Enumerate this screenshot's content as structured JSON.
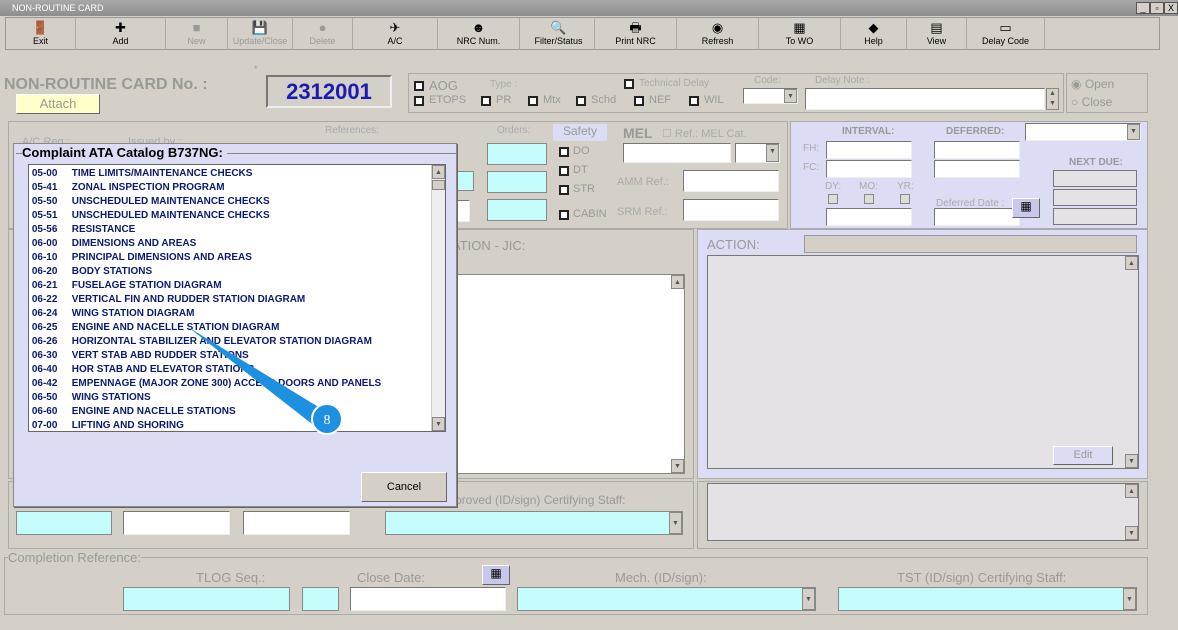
{
  "window": {
    "title": "NON-ROUTINE CARD",
    "min": "_",
    "max": "▫",
    "close": "X"
  },
  "toolbar": [
    {
      "label": "Exit",
      "icon": "exit-icon",
      "glyph": "🚪",
      "enabled": true
    },
    {
      "label": "Add",
      "icon": "plus-icon",
      "glyph": "✚",
      "enabled": true
    },
    {
      "label": "New",
      "icon": "new-icon",
      "glyph": "■",
      "enabled": false
    },
    {
      "label": "Update/Close",
      "icon": "save-icon",
      "glyph": "💾",
      "enabled": false
    },
    {
      "label": "Delete",
      "icon": "delete-icon",
      "glyph": "●",
      "enabled": false
    },
    {
      "label": "A/C",
      "icon": "aircraft-icon",
      "glyph": "✈",
      "enabled": true
    },
    {
      "label": "NRC Num.",
      "icon": "search-people-icon",
      "glyph": "☻",
      "enabled": true
    },
    {
      "label": "Filter/Status",
      "icon": "magnifier-icon",
      "glyph": "🔍",
      "enabled": true
    },
    {
      "label": "Print NRC",
      "icon": "printer-icon",
      "glyph": "🖶",
      "enabled": true
    },
    {
      "label": "Refresh",
      "icon": "refresh-icon",
      "glyph": "◉",
      "enabled": true
    },
    {
      "label": "To WO",
      "icon": "to-wo-icon",
      "glyph": "▦",
      "enabled": true
    },
    {
      "label": "Help",
      "icon": "help-icon",
      "glyph": "◆",
      "enabled": true
    },
    {
      "label": "View",
      "icon": "view-icon",
      "glyph": "▤",
      "enabled": true
    },
    {
      "label": "Delay Code",
      "icon": "delay-code-icon",
      "glyph": "▭",
      "enabled": true
    }
  ],
  "header": {
    "title": "NON-ROUTINE CARD No. :",
    "attach": "Attach",
    "card_no": "2312001",
    "required": "*"
  },
  "flags": {
    "aog": "AOG",
    "etops": "ETOPS",
    "type_label": "Type :",
    "pr": "PR",
    "mtx": "Mtx",
    "schd": "Schd",
    "nef": "NEF",
    "wil": "WIL",
    "tech_delay": "Technical Delay",
    "code": "Code:",
    "delay_note": "Delay Note :",
    "open": "Open",
    "close": "Close",
    "status": "Open"
  },
  "refs": {
    "ac_reg": "A/C Reg.:",
    "issued_by": "Issued by :",
    "references": "References:",
    "orders": "Orders:",
    "safety": "Safety",
    "do": "DO",
    "dt": "DT",
    "str": "STR",
    "cabin": "CABIN",
    "mel": "MEL",
    "ref_mel_cat": "Ref.: MEL Cat.",
    "amm": "AMM Ref.:",
    "srm": "SRM Ref.:"
  },
  "interval": {
    "interval": "INTERVAL:",
    "deferred": "DEFERRED:",
    "fh": "FH:",
    "fc": "FC:",
    "dy": "DY:",
    "mo": "MO:",
    "yr": "YR:",
    "deferred_date": "Deferred Date :",
    "next_due": "NEXT DUE:"
  },
  "middle": {
    "jic": "ATION - JIC:",
    "action": "ACTION:",
    "edit": "Edit",
    "approved": "proved (ID/sign) Certifying Staff:"
  },
  "completion": {
    "title": "Completion Reference:",
    "tlog": "TLOG Seq.:",
    "close_date": "Close Date:",
    "mech": "Mech. (ID/sign):",
    "tst": "TST (ID/sign) Certifying Staff:"
  },
  "dialog": {
    "title": "Complaint ATA Catalog B737NG:",
    "cancel": "Cancel",
    "items": [
      {
        "code": "05-00",
        "name": "TIME LIMITS/MAINTENANCE CHECKS"
      },
      {
        "code": "05-41",
        "name": "ZONAL INSPECTION PROGRAM"
      },
      {
        "code": "05-50",
        "name": "UNSCHEDULED MAINTENANCE CHECKS"
      },
      {
        "code": "05-51",
        "name": "UNSCHEDULED MAINTENANCE CHECKS"
      },
      {
        "code": "05-56",
        "name": "RESISTANCE"
      },
      {
        "code": "06-00",
        "name": "DIMENSIONS AND AREAS"
      },
      {
        "code": "06-10",
        "name": "PRINCIPAL DIMENSIONS AND AREAS"
      },
      {
        "code": "06-20",
        "name": "BODY STATIONS"
      },
      {
        "code": "06-21",
        "name": "FUSELAGE STATION DIAGRAM"
      },
      {
        "code": "06-22",
        "name": "VERTICAL FIN AND RUDDER STATION DIAGRAM"
      },
      {
        "code": "06-24",
        "name": "WING STATION DIAGRAM"
      },
      {
        "code": "06-25",
        "name": "ENGINE AND NACELLE STATION DIAGRAM"
      },
      {
        "code": "06-26",
        "name": "HORIZONTAL STABILIZER AND ELEVATOR STATION DIAGRAM"
      },
      {
        "code": "06-30",
        "name": "VERT STAB ABD RUDDER STATIONS"
      },
      {
        "code": "06-40",
        "name": "HOR STAB AND ELEVATOR STATIONS"
      },
      {
        "code": "06-42",
        "name": "EMPENNAGE (MAJOR ZONE 300) ACCESS DOORS AND PANELS"
      },
      {
        "code": "06-50",
        "name": "WING STATIONS"
      },
      {
        "code": "06-60",
        "name": "ENGINE AND NACELLE STATIONS"
      },
      {
        "code": "07-00",
        "name": "LIFTING AND SHORING"
      }
    ]
  },
  "callout": {
    "number": "8",
    "color": "#1e90e0"
  }
}
